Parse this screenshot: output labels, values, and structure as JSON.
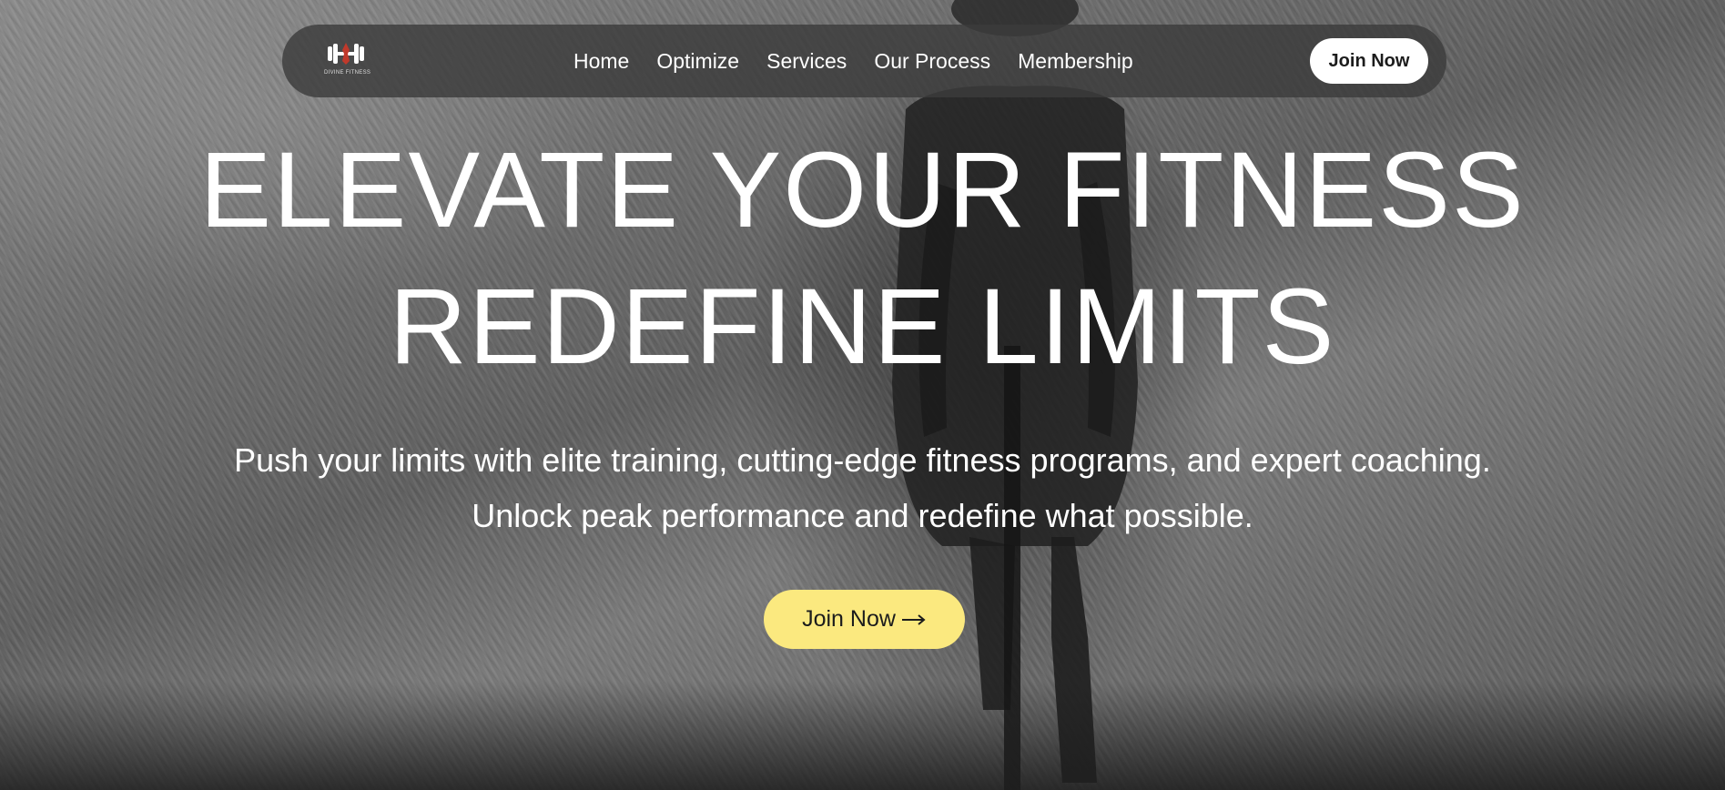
{
  "brand": {
    "logo_icon": "dumbbell-logo-icon",
    "logo_text": "DIVINE FITNESS",
    "accent_color": "#c0392b"
  },
  "nav": {
    "links": [
      {
        "label": "Home"
      },
      {
        "label": "Optimize"
      },
      {
        "label": "Services"
      },
      {
        "label": "Our Process"
      },
      {
        "label": "Membership"
      }
    ],
    "join_label": "Join Now"
  },
  "hero": {
    "headline_line1": "ELEVATE YOUR FITNESS",
    "headline_line2": "REDEFINE LIMITS",
    "sub_line1": "Push your limits with elite training, cutting-edge fitness programs, and expert coaching.",
    "sub_line2": "Unlock peak performance and redefine what possible.",
    "cta_label": "Join Now",
    "cta_icon": "arrow-right-icon",
    "cta_color": "#fbe97f",
    "background_image": "cyclist-riding-through-grass-icon"
  }
}
